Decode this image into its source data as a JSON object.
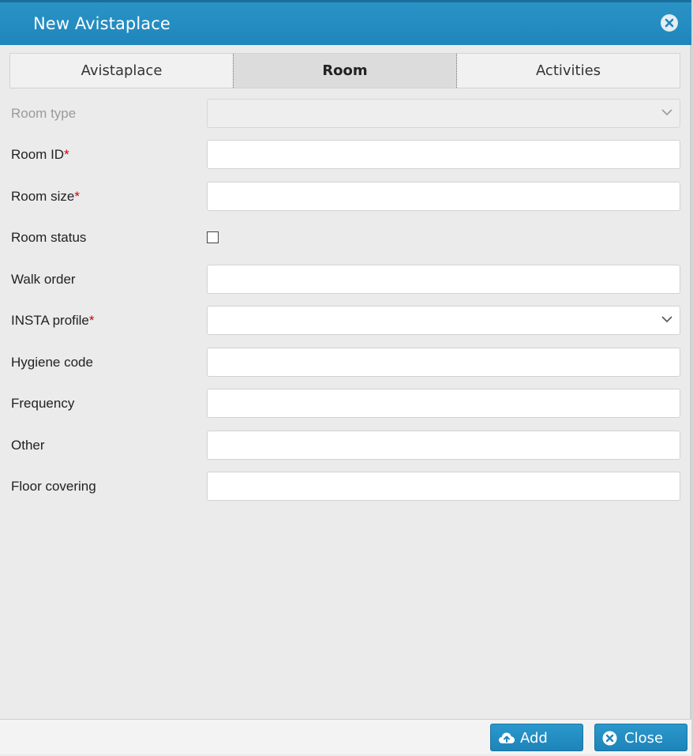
{
  "dialog": {
    "title": "New Avistaplace",
    "close_icon": "close-circle-icon"
  },
  "tabs": [
    {
      "label": "Avistaplace",
      "active": false
    },
    {
      "label": "Room",
      "active": true
    },
    {
      "label": "Activities",
      "active": false
    }
  ],
  "form": {
    "room_type": {
      "label": "Room type",
      "value": "",
      "disabled": true
    },
    "room_id": {
      "label": "Room ID",
      "required_mark": "*",
      "value": ""
    },
    "room_size": {
      "label": "Room size",
      "required_mark": "*",
      "value": ""
    },
    "room_status": {
      "label": "Room status",
      "checked": false
    },
    "walk_order": {
      "label": "Walk order",
      "value": ""
    },
    "insta_profile": {
      "label": "INSTA profile",
      "required_mark": "*",
      "value": ""
    },
    "hygiene_code": {
      "label": "Hygiene code",
      "value": ""
    },
    "frequency": {
      "label": "Frequency",
      "value": ""
    },
    "other": {
      "label": "Other",
      "value": ""
    },
    "floor_covering": {
      "label": "Floor covering",
      "value": ""
    }
  },
  "footer": {
    "add_label": "Add",
    "add_icon": "cloud-upload-icon",
    "close_label": "Close",
    "close_icon": "close-circle-icon"
  },
  "colors": {
    "accent": "#1f86bb",
    "required": "#d10000"
  }
}
